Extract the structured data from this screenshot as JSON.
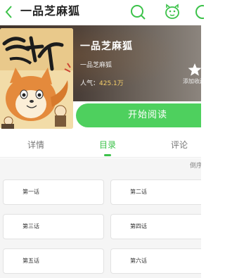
{
  "topbar": {
    "title": "一品芝麻狐",
    "icons": [
      "back-arrow-icon",
      "search-icon",
      "face-icon",
      "more-icon"
    ],
    "accent": "#3cc24a"
  },
  "book": {
    "name": "一品芝麻狐",
    "author": "一品芝麻狐",
    "popularity_label": "人气：",
    "popularity_value": "425.1万",
    "favorite_label": "添加收藏",
    "read_label": "开始阅读",
    "read_button_color": "#4ed05e"
  },
  "tabs": {
    "items": [
      {
        "label": "详情",
        "active": false
      },
      {
        "label": "目录",
        "active": true
      },
      {
        "label": "评论",
        "active": false
      }
    ]
  },
  "catalog": {
    "sort_label": "倒序",
    "chapters": [
      "第一话",
      "第二话",
      "第三话",
      "第四话",
      "第五话",
      "第六话"
    ]
  }
}
